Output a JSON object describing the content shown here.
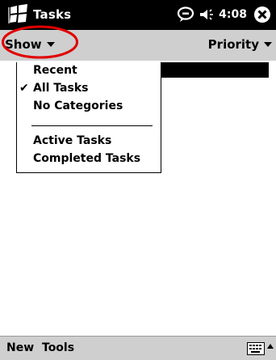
{
  "titlebar": {
    "app_title": "Tasks",
    "clock": "4:08",
    "icons": [
      "windows-start-icon",
      "notification-balloon-icon",
      "speaker-icon",
      "close-icon"
    ]
  },
  "command_bar": {
    "show_label": "Show",
    "priority_label": "Priority",
    "highlight_color": "#e00000"
  },
  "show_menu": {
    "items": [
      {
        "label": "Recent",
        "checked": false
      },
      {
        "label": "All Tasks",
        "checked": true
      },
      {
        "label": "No Categories",
        "checked": false
      },
      {
        "label": "Active Tasks",
        "checked": false
      },
      {
        "label": "Completed Tasks",
        "checked": false
      }
    ],
    "check_glyph": "✔"
  },
  "bottom_bar": {
    "new_label": "New",
    "tools_label": "Tools"
  }
}
